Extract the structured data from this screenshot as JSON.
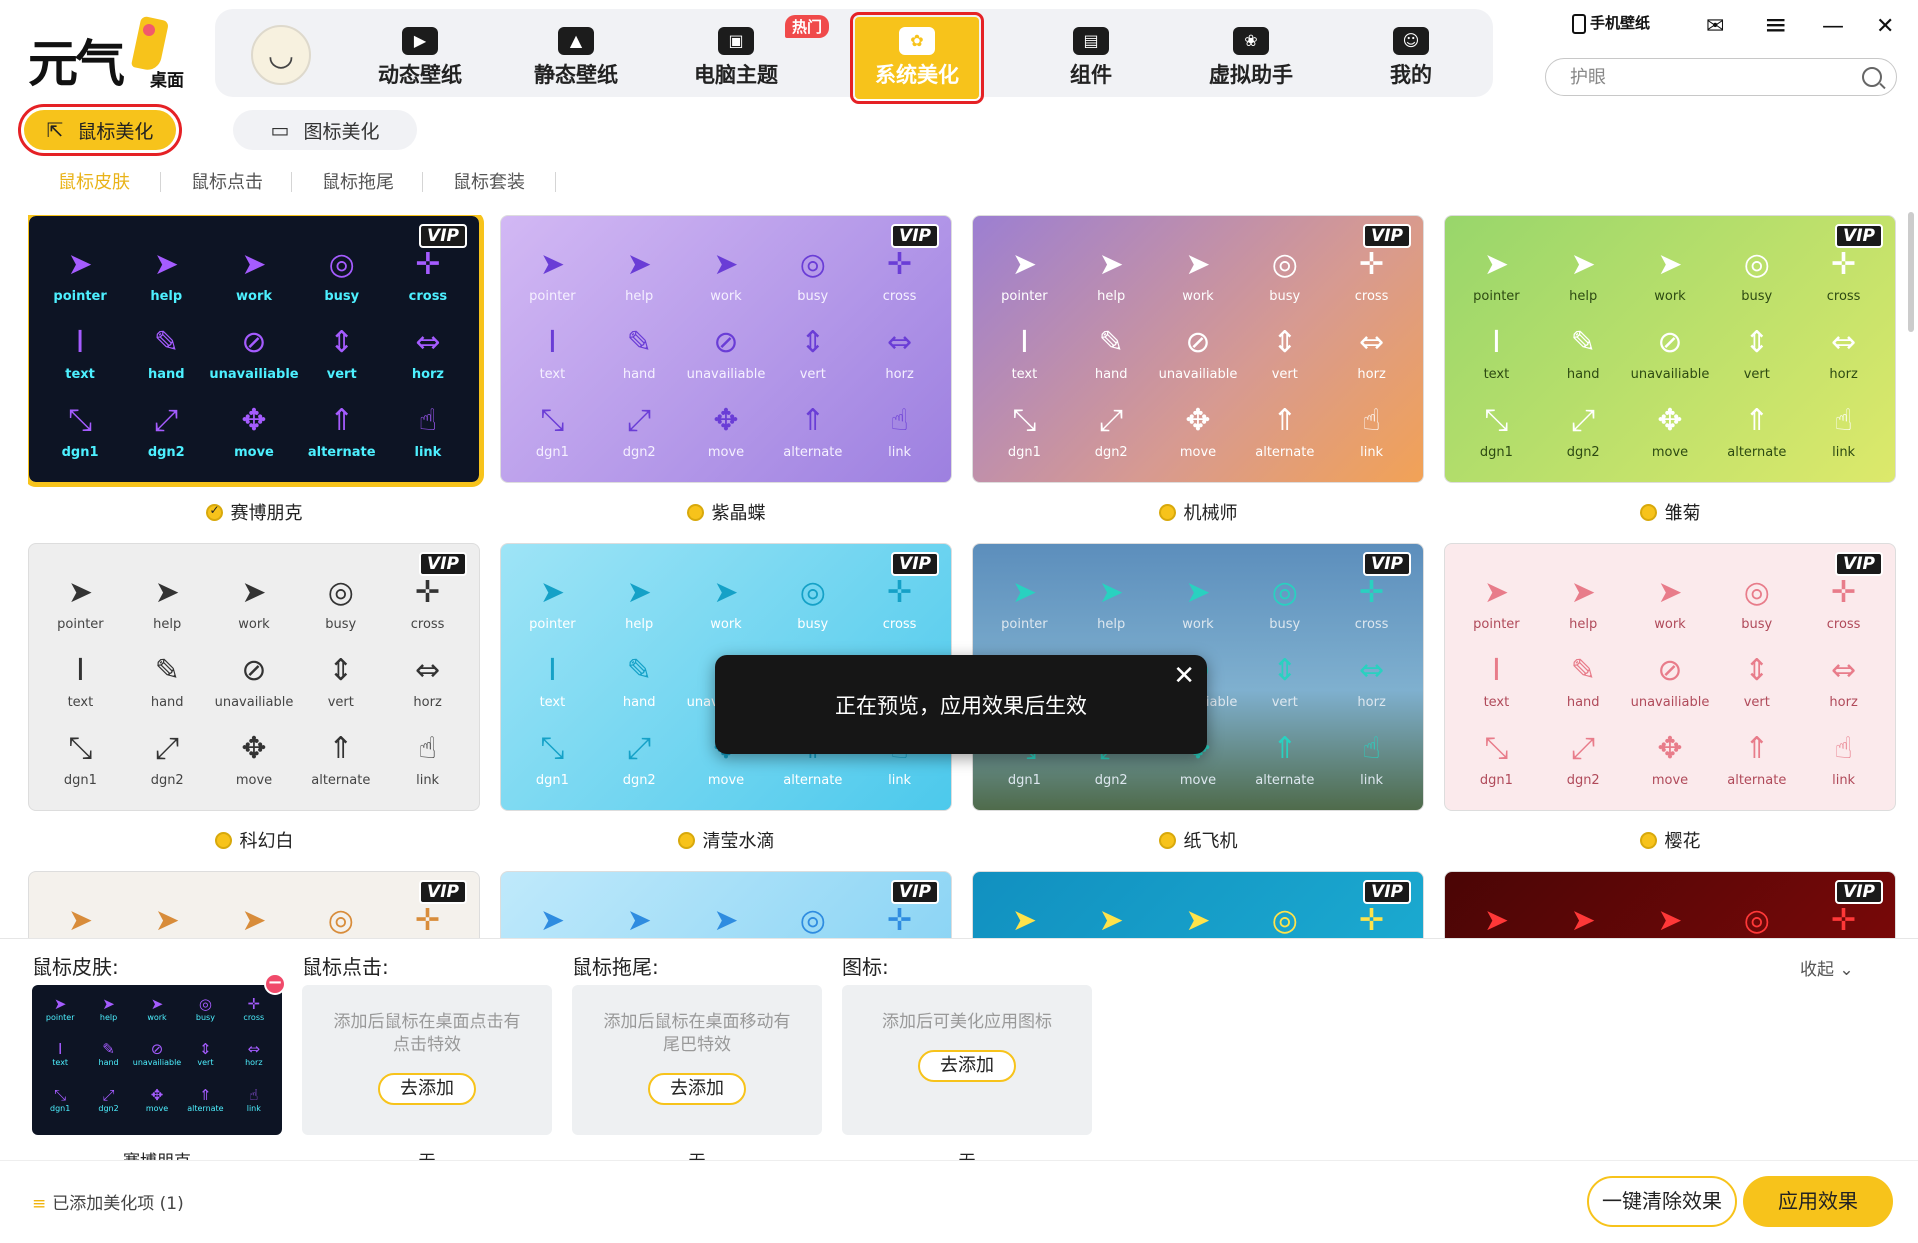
{
  "logo": {
    "big": "元气",
    "small": "桌面"
  },
  "nav": {
    "avatar": "◡",
    "items": [
      {
        "label": "动态壁纸",
        "icon": "▶"
      },
      {
        "label": "静态壁纸",
        "icon": "▲"
      },
      {
        "label": "电脑主题",
        "icon": "▣"
      },
      {
        "label": "系统美化",
        "icon": "✿"
      },
      {
        "label": "组件",
        "icon": "▤"
      },
      {
        "label": "虚拟助手",
        "icon": "❀"
      },
      {
        "label": "我的",
        "icon": "☺"
      }
    ],
    "hot_badge": "热门"
  },
  "window": {
    "phone_wallpaper": "手机壁纸",
    "mail_icon": "✉",
    "menu_icon": "≡",
    "min_icon": "—",
    "close_icon": "✕"
  },
  "search": {
    "placeholder": "护眼"
  },
  "subtabs": {
    "active": "鼠标美化",
    "other": "图标美化",
    "active_icon": "⇱",
    "other_icon": "▭"
  },
  "subsubtabs": [
    "鼠标皮肤",
    "鼠标点击",
    "鼠标拖尾",
    "鼠标套装"
  ],
  "cursor_labels": [
    "pointer",
    "help",
    "work",
    "busy",
    "cross",
    "text",
    "hand",
    "unavailiable",
    "vert",
    "horz",
    "dgn1",
    "dgn2",
    "move",
    "alternate",
    "link"
  ],
  "cursor_glyphs": [
    "➤",
    "➤",
    "➤",
    "◎",
    "✛",
    "Ⅰ",
    "✎",
    "⊘",
    "⇕",
    "⇔",
    "⤡",
    "⤢",
    "✥",
    "⇑",
    "☝"
  ],
  "vip_label": "VIP",
  "cards": [
    {
      "name": "赛博朋克",
      "selected": true
    },
    {
      "name": "紫晶蝶",
      "selected": false
    },
    {
      "name": "机械师",
      "selected": false
    },
    {
      "name": "雏菊",
      "selected": false
    },
    {
      "name": "科幻白",
      "selected": false
    },
    {
      "name": "清莹水滴",
      "selected": false
    },
    {
      "name": "纸飞机",
      "selected": false
    },
    {
      "name": "樱花",
      "selected": false
    }
  ],
  "toast": {
    "text": "正在预览，应用效果后生效",
    "close": "✕"
  },
  "panel": {
    "skin_title": "鼠标皮肤:",
    "click_title": "鼠标点击:",
    "trail_title": "鼠标拖尾:",
    "icon_title": "图标:",
    "click_hint": "添加后鼠标在桌面点击有点击特效",
    "trail_hint": "添加后鼠标在桌面移动有尾巴特效",
    "icon_hint": "添加后可美化应用图标",
    "add_label": "去添加",
    "skin_name": "赛博朋克",
    "none_label": "无",
    "remove": "−",
    "collapse": "收起 ⌄"
  },
  "footer": {
    "added": "已添加美化项 (1)",
    "added_icon": "≡",
    "clear": "一键清除效果",
    "apply": "应用效果"
  }
}
